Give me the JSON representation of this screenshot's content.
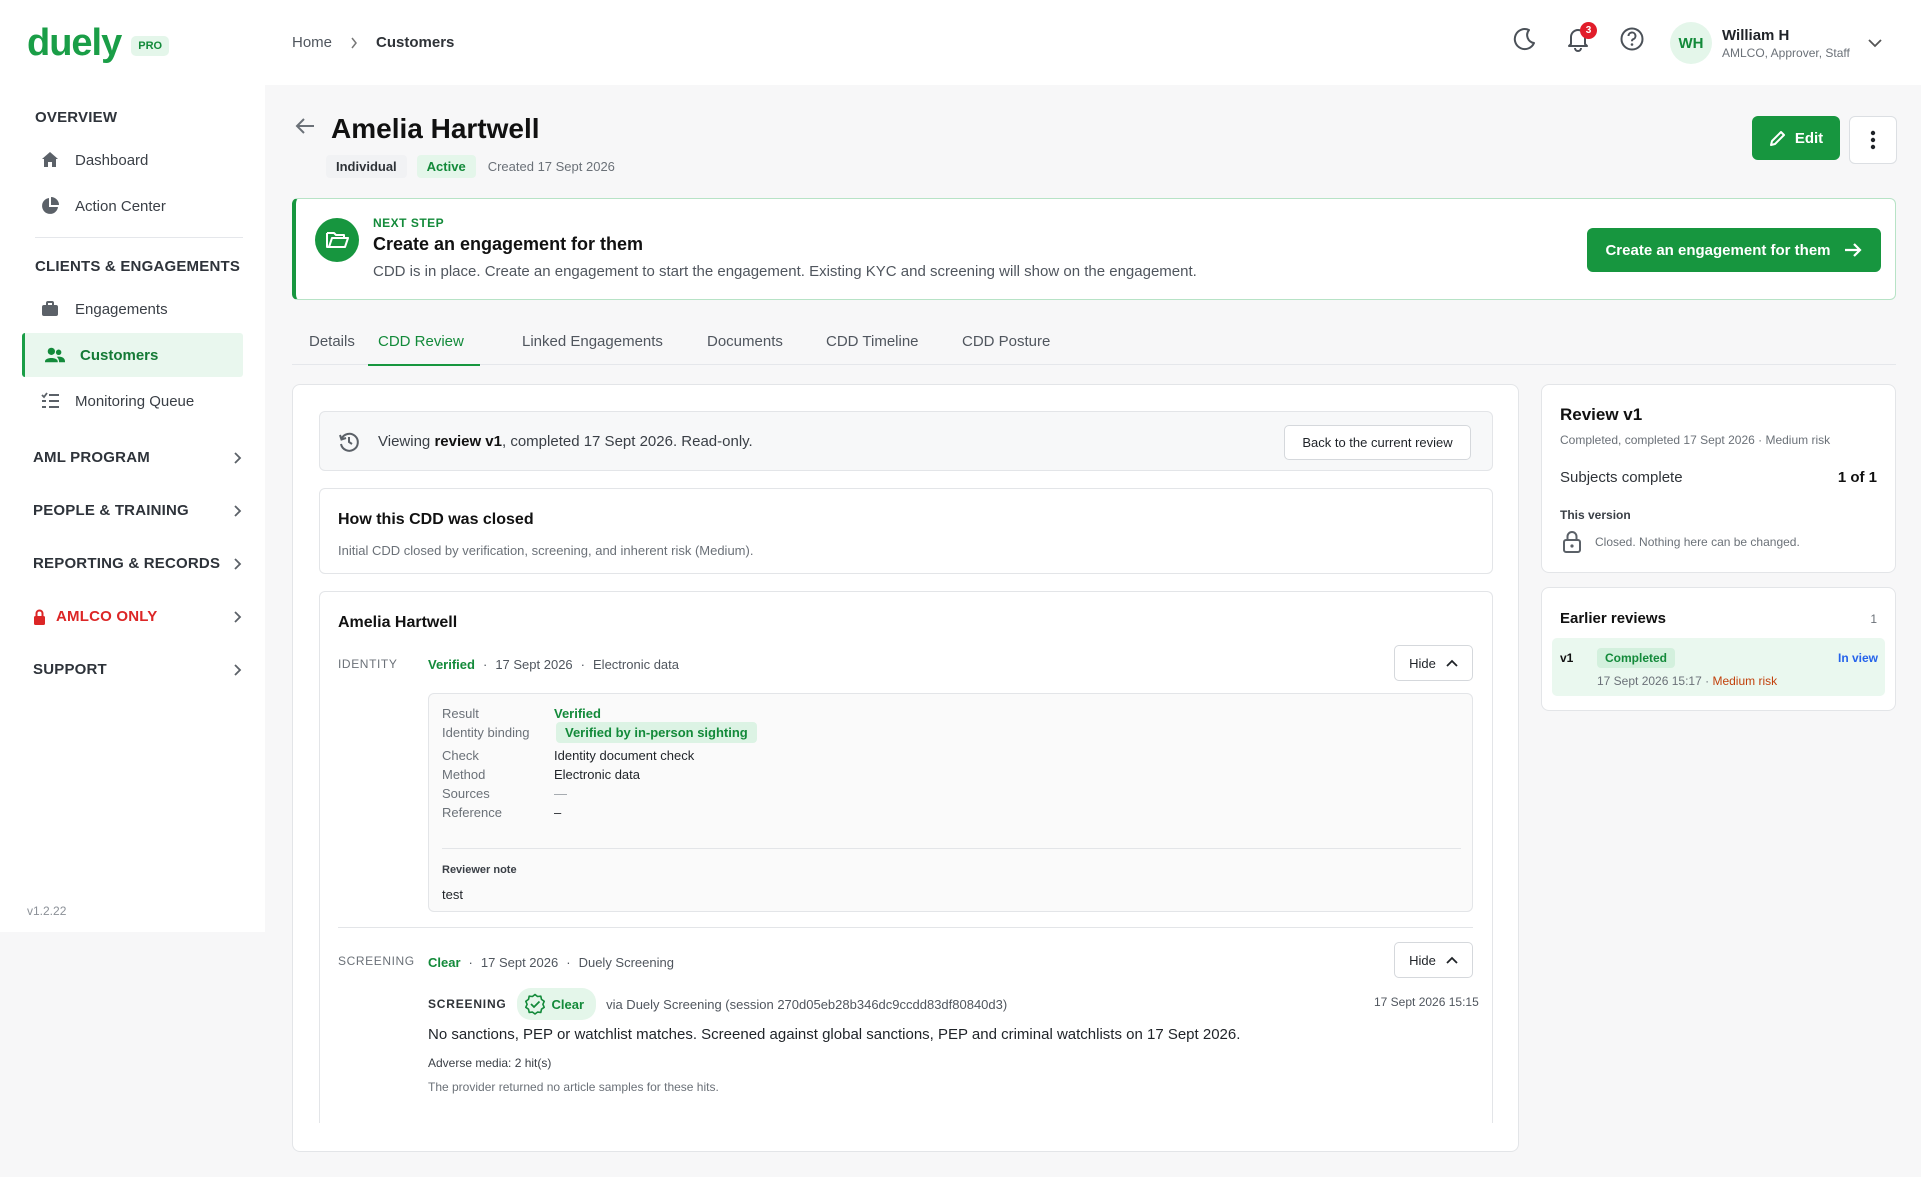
{
  "app": {
    "logo": "duely",
    "plan_badge": "PRO",
    "version": "v1.2.22"
  },
  "sidebar": {
    "sections": [
      {
        "label": "OVERVIEW"
      },
      {
        "label": "CLIENTS & ENGAGEMENTS"
      }
    ],
    "items": [
      {
        "label": "Dashboard",
        "icon": "home-icon"
      },
      {
        "label": "Action Center",
        "icon": "pie-chart-icon"
      },
      {
        "label": "Engagements",
        "icon": "briefcase-icon"
      },
      {
        "label": "Customers",
        "icon": "users-icon",
        "active": true
      },
      {
        "label": "Monitoring Queue",
        "icon": "list-check-icon"
      }
    ],
    "groups": [
      {
        "label": "AML PROGRAM"
      },
      {
        "label": "PEOPLE & TRAINING"
      },
      {
        "label": "REPORTING & RECORDS"
      },
      {
        "label": "AMLCO ONLY",
        "color": "#dc2626"
      },
      {
        "label": "SUPPORT"
      }
    ]
  },
  "topbar": {
    "breadcrumb": [
      "Home",
      "Customers"
    ],
    "notification_count": "3",
    "user": {
      "initials": "WH",
      "name": "William H",
      "roles": "AMLCO, Approver, Staff"
    }
  },
  "header": {
    "title": "Amelia Hartwell",
    "type_chip": "Individual",
    "status_chip": "Active",
    "created": "Created 17 Sept 2026",
    "edit_label": "Edit"
  },
  "banner": {
    "kicker": "NEXT STEP",
    "title": "Create an engagement for them",
    "description": "CDD is in place. Create an engagement to start the engagement. Existing KYC and screening will show on the engagement.",
    "button_label": "Create an engagement for them"
  },
  "tabs": [
    {
      "label": "Details"
    },
    {
      "label": "CDD Review",
      "active": true
    },
    {
      "label": "Linked Engagements"
    },
    {
      "label": "Documents"
    },
    {
      "label": "CDD Timeline"
    },
    {
      "label": "CDD Posture"
    }
  ],
  "viewing": {
    "prefix": "Viewing ",
    "review": "review v1",
    "suffix": ", completed 17 Sept 2026. Read-only.",
    "back_button": "Back to the current review"
  },
  "closure": {
    "title": "How this CDD was closed",
    "description": "Initial CDD closed by verification, screening, and inherent risk (Medium)."
  },
  "subject": {
    "name": "Amelia Hartwell",
    "identity": {
      "label": "IDENTITY",
      "status": "Verified",
      "date": "17 Sept 2026",
      "method": "Electronic data",
      "hide_label": "Hide",
      "details": {
        "result_label": "Result",
        "result": "Verified",
        "binding_label": "Identity binding",
        "binding": "Verified by in-person sighting",
        "check_label": "Check",
        "check": "Identity document check",
        "method_label": "Method",
        "method": "Electronic data",
        "sources_label": "Sources",
        "sources": "—",
        "reference_label": "Reference",
        "reference": "–",
        "note_label": "Reviewer note",
        "note": "test"
      }
    },
    "screening": {
      "label": "SCREENING",
      "status": "Clear",
      "date": "17 Sept 2026",
      "provider": "Duely Screening",
      "hide_label": "Hide",
      "kicker": "SCREENING",
      "chip": "Clear",
      "via": "via Duely Screening (session 270d05eb28b346dc9ccdd83df80840d3)",
      "timestamp": "17 Sept 2026 15:15",
      "summary": "No sanctions, PEP or watchlist matches. Screened against global sanctions, PEP and criminal watchlists on 17 Sept 2026.",
      "adverse_media": "Adverse media: 2 hit(s)",
      "note": "The provider returned no article samples for these hits."
    }
  },
  "review_card": {
    "title": "Review v1",
    "subtitle": "Completed, completed 17 Sept 2026 · Medium risk",
    "subjects_label": "Subjects complete",
    "subjects_value": "1 of 1",
    "version_label": "This version",
    "lock_text": "Closed. Nothing here can be changed."
  },
  "earlier_reviews": {
    "title": "Earlier reviews",
    "count": "1",
    "items": [
      {
        "version": "v1",
        "status": "Completed",
        "in_view": "In view",
        "date": "17 Sept 2026 15:17",
        "risk": "Medium risk"
      }
    ]
  }
}
